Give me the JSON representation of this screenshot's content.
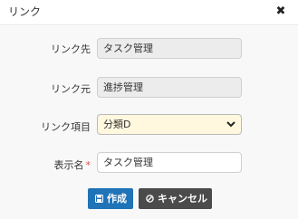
{
  "dialog": {
    "title": "リンク",
    "close_icon": "close-icon"
  },
  "form": {
    "link_dest": {
      "label": "リンク先",
      "value": "タスク管理"
    },
    "link_src": {
      "label": "リンク元",
      "value": "進捗管理"
    },
    "link_item": {
      "label": "リンク項目",
      "value": "分類D"
    },
    "display_name": {
      "label": "表示名",
      "required_mark": "*",
      "value": "タスク管理"
    }
  },
  "buttons": {
    "create": {
      "label": "作成",
      "icon": "save-icon"
    },
    "cancel": {
      "label": "キャンセル",
      "icon": "ban-icon"
    }
  },
  "colors": {
    "primary": "#1f73b7",
    "cancel": "#4b4b4b",
    "required": "#d9534f",
    "select_bg": "#fff8df"
  }
}
